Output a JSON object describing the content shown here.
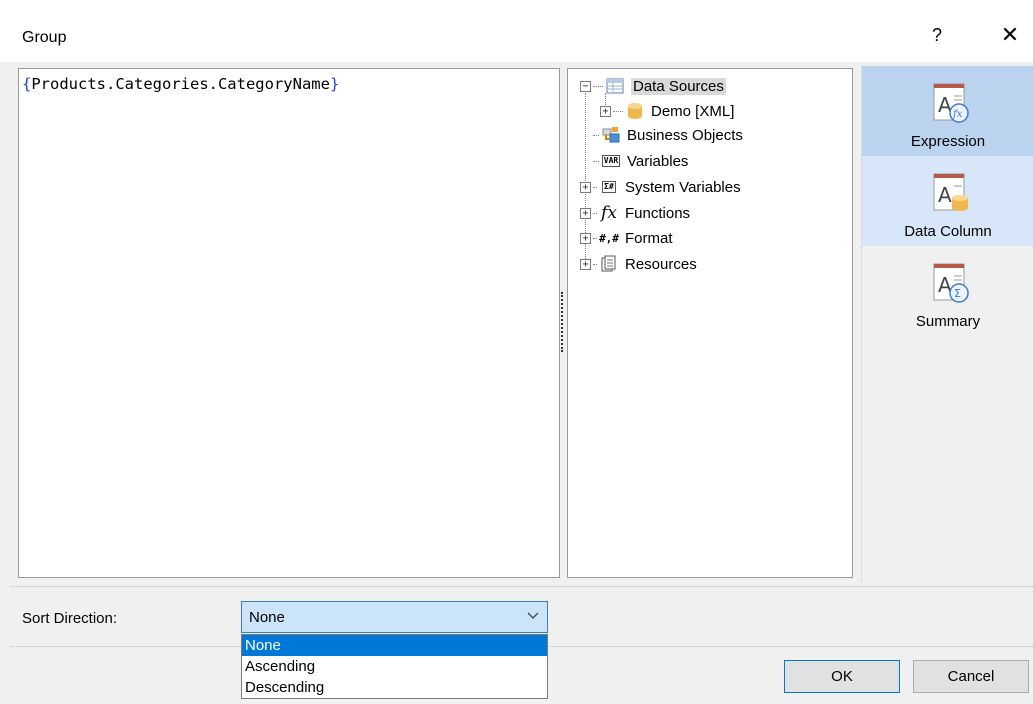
{
  "window": {
    "title": "Group",
    "help_label": "?",
    "close_label": "✕"
  },
  "editor": {
    "expression_open": "{",
    "expression_body": "Products.Categories.CategoryName",
    "expression_close": "}"
  },
  "tree": {
    "items": [
      {
        "label": "Data Sources",
        "icon": "data-sources-icon",
        "expander": "−",
        "selected": true
      },
      {
        "label": "Demo [XML]",
        "icon": "database-icon",
        "expander": "+"
      },
      {
        "label": "Business Objects",
        "icon": "business-objects-icon"
      },
      {
        "label": "Variables",
        "icon": "variables-icon",
        "icon_text": "VAR"
      },
      {
        "label": "System Variables",
        "icon": "system-variables-icon",
        "icon_text": "Σ#",
        "expander": "+"
      },
      {
        "label": "Functions",
        "icon": "functions-icon",
        "icon_text": "fx",
        "expander": "+"
      },
      {
        "label": "Format",
        "icon": "format-icon",
        "icon_text": "#,#",
        "expander": "+"
      },
      {
        "label": "Resources",
        "icon": "resources-icon",
        "expander": "+"
      }
    ]
  },
  "side_panel": {
    "items": [
      {
        "label": "Expression",
        "icon": "expression-icon",
        "state": "active"
      },
      {
        "label": "Data Column",
        "icon": "data-column-icon",
        "state": "hover"
      },
      {
        "label": "Summary",
        "icon": "summary-icon",
        "state": "normal"
      }
    ]
  },
  "sort": {
    "label": "Sort Direction:",
    "selected": "None",
    "options": [
      "None",
      "Ascending",
      "Descending"
    ]
  },
  "buttons": {
    "ok": "OK",
    "cancel": "Cancel"
  },
  "colors": {
    "accent": "#0078d7",
    "panel_active": "#bcd3f0",
    "panel_hover": "#d7e6f8",
    "brace": "#1f3fd0"
  }
}
